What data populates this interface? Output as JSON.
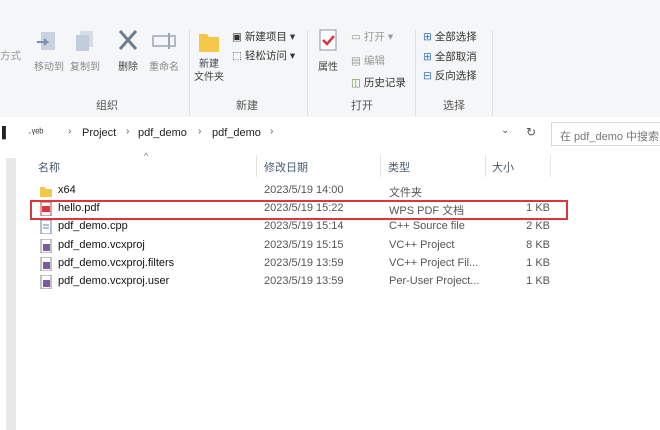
{
  "ribbon": {
    "partial_left": "方式",
    "move_to": "移动到",
    "copy_to": "复制到",
    "delete": "删除",
    "rename": "重命名",
    "organize_group": "组织",
    "new_folder": "新建\n文件夹",
    "new_item": "新建项目",
    "easy_access": "轻松访问",
    "new_group": "新建",
    "properties": "属性",
    "open": "打开",
    "edit": "编辑",
    "history": "历史记录",
    "open_group": "打开",
    "select_all": "全部选择",
    "select_none": "全部取消",
    "invert_selection": "反向选择",
    "select_group": "选择"
  },
  "address": {
    "obscured": "·ᵞᵉᵇ",
    "crumbs": [
      "Project",
      "pdf_demo",
      "pdf_demo"
    ],
    "search_placeholder": "在 pdf_demo 中搜索"
  },
  "columns": {
    "name": "名称",
    "date": "修改日期",
    "type": "类型",
    "size": "大小"
  },
  "files": [
    {
      "name": "x64",
      "date": "2023/5/19 14:00",
      "type": "文件夹",
      "size": "",
      "icon": "folder-icon",
      "color": "#f3c84a"
    },
    {
      "name": "hello.pdf",
      "date": "2023/5/19 15:22",
      "type": "WPS PDF 文档",
      "size": "1 KB",
      "icon": "pdf-file-icon",
      "color": "#d9363e"
    },
    {
      "name": "pdf_demo.cpp",
      "date": "2023/5/19 15:14",
      "type": "C++ Source file",
      "size": "2 KB",
      "icon": "cpp-file-icon",
      "color": "#6b7fa8"
    },
    {
      "name": "pdf_demo.vcxproj",
      "date": "2023/5/19 15:15",
      "type": "VC++ Project",
      "size": "8 KB",
      "icon": "vcxproj-file-icon",
      "color": "#7a5aa6"
    },
    {
      "name": "pdf_demo.vcxproj.filters",
      "date": "2023/5/19 13:59",
      "type": "VC++ Project Fil...",
      "size": "1 KB",
      "icon": "filters-file-icon",
      "color": "#7a5aa6"
    },
    {
      "name": "pdf_demo.vcxproj.user",
      "date": "2023/5/19 13:59",
      "type": "Per-User Project...",
      "size": "1 KB",
      "icon": "user-file-icon",
      "color": "#7a5aa6"
    }
  ],
  "colors": {
    "highlight": "#d9363e",
    "header_text": "#4a5b74",
    "ribbon_bg": "#f5f6f7"
  }
}
